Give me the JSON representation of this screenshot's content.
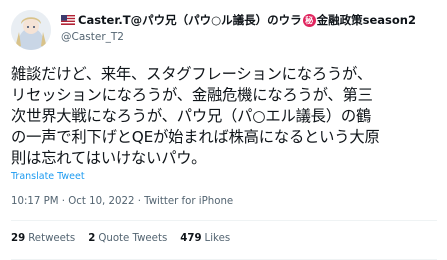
{
  "author": {
    "flag_icon": "us-flag-icon",
    "display_name_part1": "Caster.T@パウ兄（パウ○ル議長）のウラ",
    "seal_char": "秘",
    "display_name_part2": "金融政策season2",
    "handle": "@Caster_T2"
  },
  "tweet": {
    "lines": [
      "雑談だけど、来年、スタグフレーションになろうが、",
      "リセッションになろうが、金融危機になろうが、第三",
      "次世界大戦になろうが、パウ兄（パ○エル議長）の鶴",
      "の一声で利下げとQEが始まれば株高になるという大原",
      "則は忘れてはいけないパウ。"
    ],
    "translate_label": "Translate Tweet",
    "timestamp": "10:17 PM · Oct 10, 2022 · Twitter for iPhone"
  },
  "stats": {
    "retweets_count": "29",
    "retweets_label": "Retweets",
    "quotes_count": "2",
    "quotes_label": "Quote Tweets",
    "likes_count": "479",
    "likes_label": "Likes"
  },
  "colors": {
    "link": "#1d9bf0",
    "secondary_text": "#536471",
    "seal_red": "#e0245e"
  }
}
